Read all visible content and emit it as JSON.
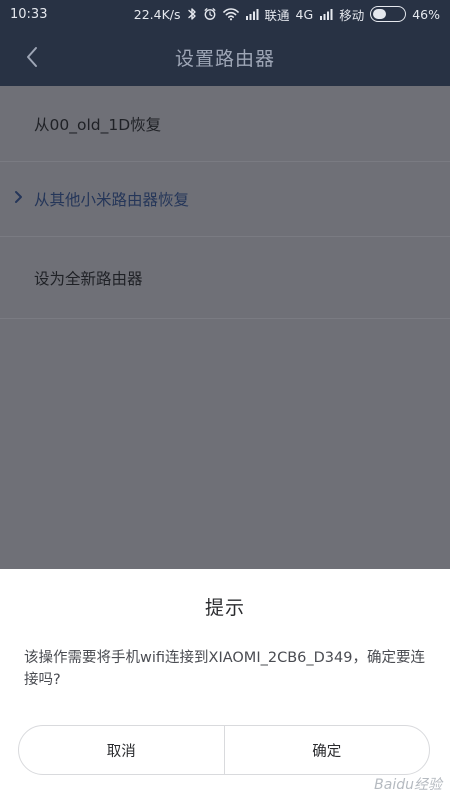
{
  "status_bar": {
    "time": "10:33",
    "network_speed": "22.4K/s",
    "carrier1": "联通",
    "network_type": "4G",
    "carrier2": "移动",
    "battery": "46%",
    "battery_level": 0.46
  },
  "header": {
    "title": "设置路由器"
  },
  "options": [
    {
      "label": "从00_old_1D恢复"
    },
    {
      "label": "从其他小米路由器恢复"
    },
    {
      "label": "设为全新路由器"
    }
  ],
  "dialog": {
    "title": "提示",
    "message": "该操作需要将手机wifi连接到XIAOMI_2CB6_D349，确定要连接吗?",
    "cancel_label": "取消",
    "confirm_label": "确定"
  },
  "watermark": {
    "text": "Baidu经验"
  },
  "colors": {
    "header_bg": "#283244",
    "overlay_bg": "#6f7077",
    "dialog_bg": "#ffffff",
    "selected_text": "#253659"
  }
}
